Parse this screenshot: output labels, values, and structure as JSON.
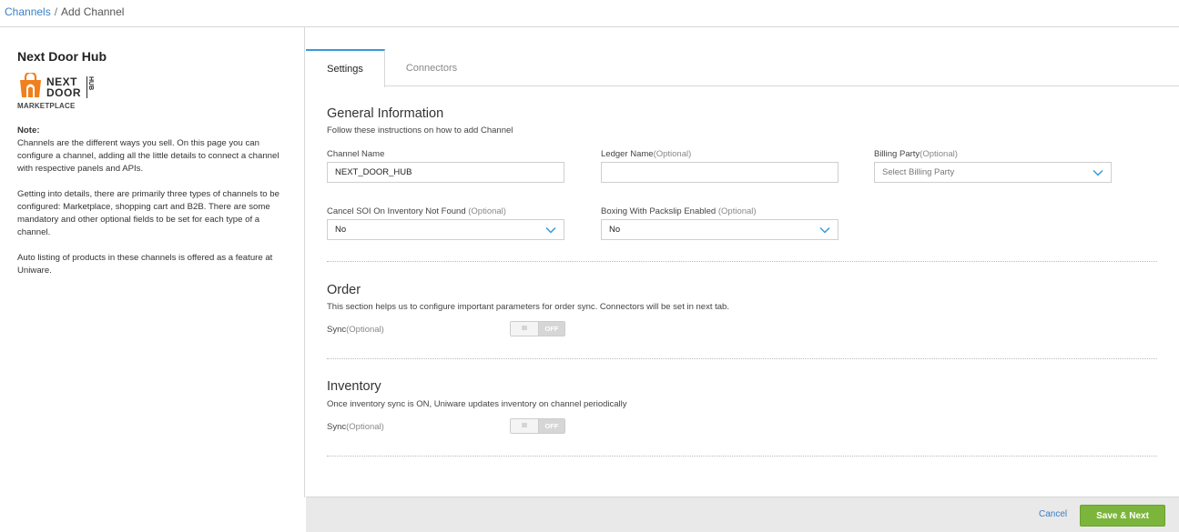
{
  "breadcrumb": {
    "parent": "Channels",
    "separator": "/",
    "current": "Add Channel"
  },
  "left": {
    "channel_name": "Next Door Hub",
    "logo": {
      "line1": "NEXT",
      "line2": "DOOR",
      "side": "HUB",
      "subtitle": "MARKETPLACE",
      "brand_color": "#f07f1c",
      "icon": "shopping-bag-icon"
    },
    "note_title": "Note:",
    "note_paragraphs": [
      "Channels are the different ways you sell. On this page you can configure a channel, adding all the little details to connect a channel with respective panels and APIs.",
      "Getting into details, there are primarily three types of channels to be configured: Marketplace, shopping cart and B2B. There are some mandatory and other optional fields to be set for each type of a channel.",
      "Auto listing of products in these channels is offered as a feature at Uniware."
    ]
  },
  "tabs": [
    {
      "label": "Settings",
      "active": true
    },
    {
      "label": "Connectors",
      "active": false
    }
  ],
  "general": {
    "title": "General Information",
    "subtitle": "Follow these instructions on how to add Channel",
    "channel_name": {
      "label": "Channel Name",
      "value": "NEXT_DOOR_HUB"
    },
    "ledger_name": {
      "label": "Ledger Name",
      "optional": "(Optional)",
      "value": ""
    },
    "billing_party": {
      "label": "Billing Party",
      "optional": "(Optional)",
      "placeholder": "Select Billing Party"
    },
    "cancel_soi": {
      "label": "Cancel SOI On Inventory Not Found",
      "optional": " (Optional)",
      "value": "No"
    },
    "boxing": {
      "label": "Boxing With Packslip Enabled",
      "optional": " (Optional)",
      "value": "No"
    }
  },
  "order": {
    "title": "Order",
    "subtitle": "This section helps us to configure important parameters for order sync. Connectors will be set in next tab.",
    "sync_label": "Sync",
    "sync_optional": "(Optional)",
    "sync_knob": "III",
    "sync_state": "OFF"
  },
  "inventory": {
    "title": "Inventory",
    "subtitle": "Once inventory sync is ON, Uniware updates inventory on channel periodically",
    "sync_label": "Sync",
    "sync_optional": "(Optional)",
    "sync_knob": "III",
    "sync_state": "OFF"
  },
  "footer": {
    "cancel_label": "Cancel",
    "save_label": "Save & Next",
    "save_color": "#7cb53b"
  },
  "icons": {
    "dropdown": "chevron-down-icon",
    "accent": "#3a9ad9"
  }
}
